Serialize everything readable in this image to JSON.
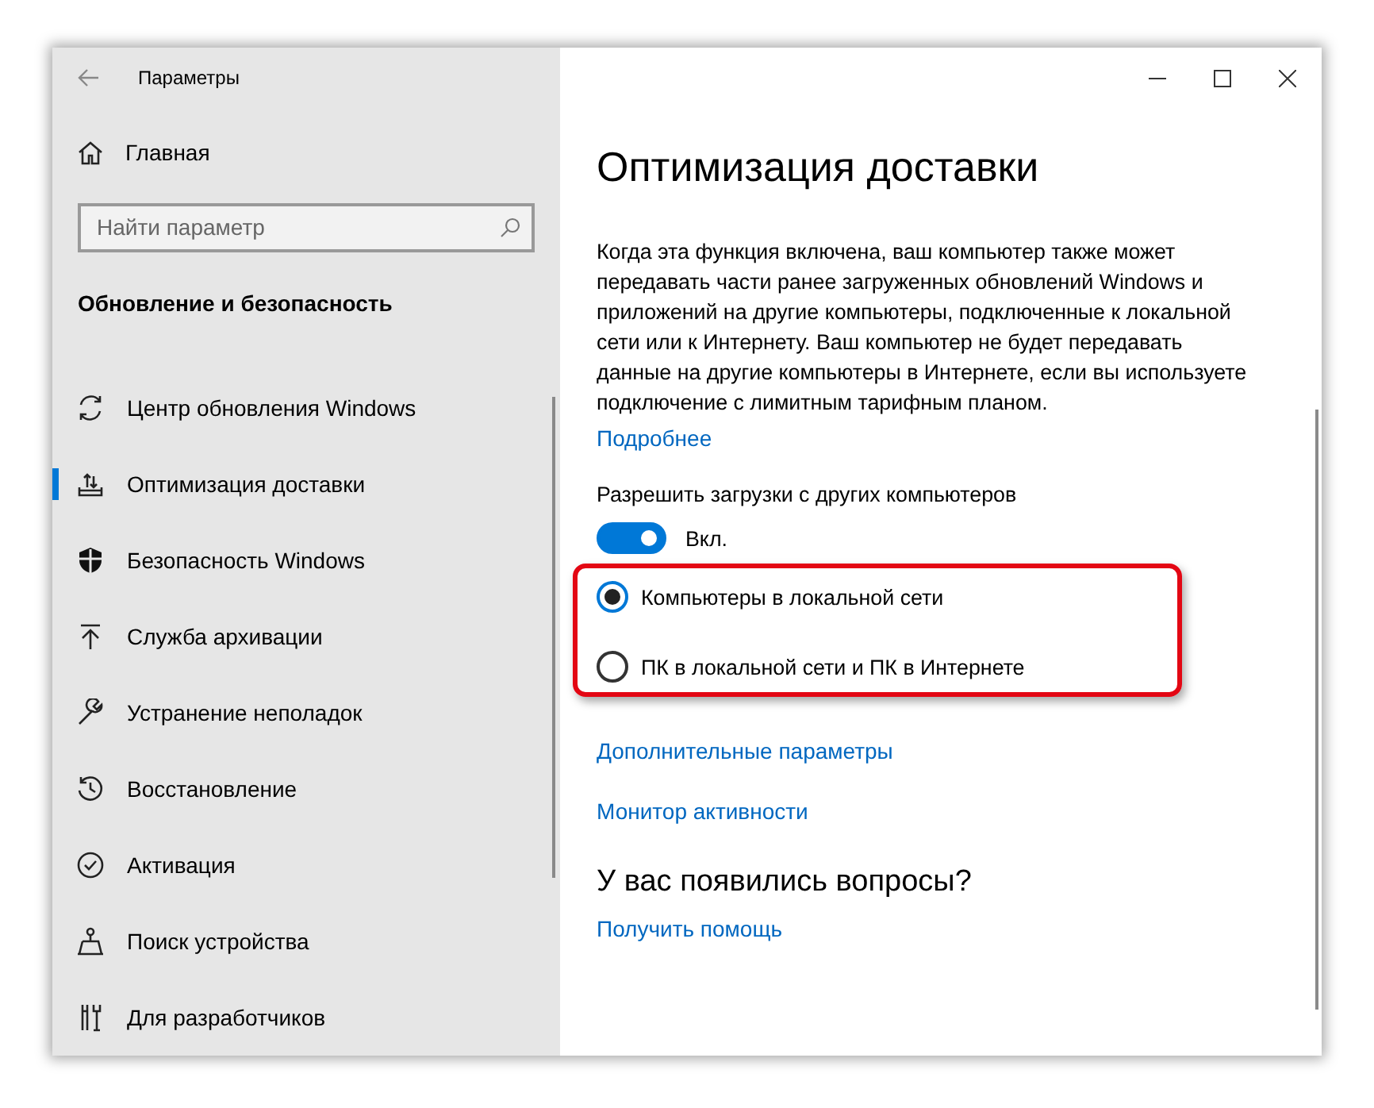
{
  "window": {
    "title": "Параметры"
  },
  "sidebar": {
    "home": "Главная",
    "search": {
      "placeholder": "Найти параметр"
    },
    "section_title": "Обновление и безопасность",
    "items": [
      {
        "label": "Центр обновления Windows",
        "selected": false
      },
      {
        "label": "Оптимизация доставки",
        "selected": true
      },
      {
        "label": "Безопасность Windows",
        "selected": false
      },
      {
        "label": "Служба архивации",
        "selected": false
      },
      {
        "label": "Устранение неполадок",
        "selected": false
      },
      {
        "label": "Восстановление",
        "selected": false
      },
      {
        "label": "Активация",
        "selected": false
      },
      {
        "label": "Поиск устройства",
        "selected": false
      },
      {
        "label": "Для разработчиков",
        "selected": false
      }
    ]
  },
  "content": {
    "title": "Оптимизация доставки",
    "description": "Когда эта функция включена, ваш компьютер также может передавать части ранее загруженных обновлений Windows и приложений на другие компьютеры, подключенные к локальной сети или к Интернету. Ваш компьютер не будет передавать данные на другие компьютеры в Интернете, если вы используете подключение с лимитным тарифным планом.",
    "more_link": "Подробнее",
    "toggle": {
      "label": "Разрешить загрузки с других компьютеров",
      "on": true,
      "state_text": "Вкл."
    },
    "radios": [
      {
        "label": "Компьютеры в локальной сети",
        "selected": true
      },
      {
        "label": "ПК в локальной сети и ПК в Интернете",
        "selected": false
      }
    ],
    "links": [
      "Дополнительные параметры",
      "Монитор активности"
    ],
    "help": {
      "heading": "У вас появились вопросы?",
      "link": "Получить помощь"
    }
  }
}
